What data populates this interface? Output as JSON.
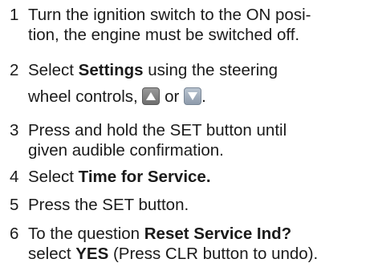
{
  "steps": [
    {
      "number": "1",
      "lines": [
        "Turn the ignition switch to the ON posi-",
        "tion, the engine must be switched off."
      ]
    },
    {
      "number": "2",
      "line1_prefix": "Select ",
      "line1_bold": "Settings",
      "line1_suffix": " using the steering",
      "line2_prefix": "wheel controls, ",
      "line2_middle": " or ",
      "line2_suffix": ".",
      "icons": [
        "up-arrow-button-icon",
        "down-arrow-button-icon"
      ]
    },
    {
      "number": "3",
      "lines": [
        "Press and hold the SET button until",
        "given audible confirmation."
      ]
    },
    {
      "number": "4",
      "prefix": "Select ",
      "bold": "Time for Service."
    },
    {
      "number": "5",
      "text": "Press the SET button."
    },
    {
      "number": "6",
      "line1_prefix": "To the question ",
      "line1_bold": "Reset Service Ind?",
      "line2_prefix": "select ",
      "line2_bold": "YES",
      "line2_suffix": " (Press CLR button to undo)."
    }
  ]
}
